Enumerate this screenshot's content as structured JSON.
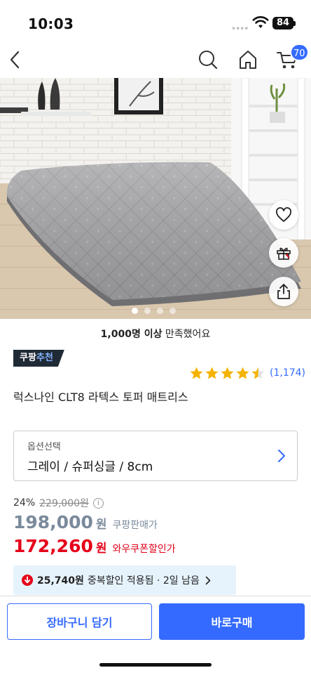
{
  "status_bar": {
    "time": "10:03",
    "battery": "84"
  },
  "nav": {
    "cart_count": "70"
  },
  "gallery": {
    "slide_count": 4,
    "active_index": 0
  },
  "satisfaction": {
    "count": "1,000명 이상",
    "suffix": " 만족했어요"
  },
  "badge": {
    "left": "쿠팡",
    "right": "추천"
  },
  "rating": {
    "stars": 4.5,
    "count": "(1,174)"
  },
  "product": {
    "title": "럭스나인 CLT8 라텍스 토퍼 매트리스"
  },
  "option": {
    "label": "옵션선택",
    "value": "그레이 / 슈퍼싱글 / 8cm"
  },
  "pricing": {
    "discount_rate": "24%",
    "original_price": "229,000원",
    "sale_price": "198,000",
    "sale_unit": "원",
    "sale_label": "쿠팡판매가",
    "coupon_price": "172,260",
    "coupon_unit": "원",
    "coupon_label": "와우쿠폰할인가"
  },
  "coupon_banner": {
    "amount": "25,740원",
    "text": "중복할인 적용됨 · 2일 남음"
  },
  "actions": {
    "add_to_cart": "장바구니 담기",
    "buy_now": "바로구매"
  },
  "colors": {
    "accent": "#346aff",
    "price_red": "#e5001a",
    "badge_dark": "#1f2a36"
  }
}
